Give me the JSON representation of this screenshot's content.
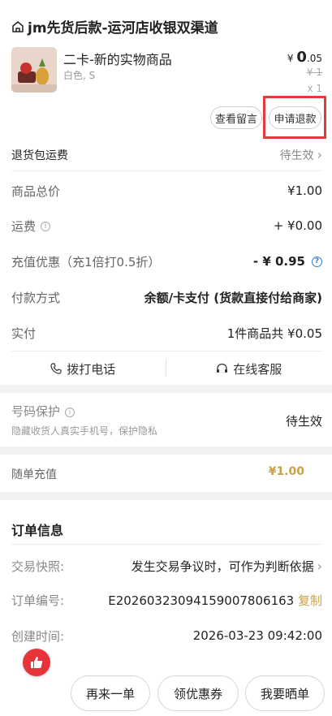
{
  "shop": {
    "name": "jm先货后款-运河店收银双渠道"
  },
  "product": {
    "title": "二卡-新的实物商品",
    "spec": "白色, S",
    "price_symbol": "¥",
    "price_int": "0",
    "price_dec": ".05",
    "orig_price": "¥ 1",
    "qty": "x 1"
  },
  "actions": {
    "msg_label": "查看留言",
    "refund_label": "申请退款"
  },
  "return_shipping": {
    "label": "退货包运费",
    "value": "待生效"
  },
  "summary": [
    {
      "label": "商品总价",
      "value": "¥1.00"
    },
    {
      "label": "运费",
      "value": "+ ¥0.00"
    },
    {
      "label": "充值优惠（充1倍打0.5折）",
      "value": "- ¥ 0.95"
    },
    {
      "label": "付款方式",
      "value": "余额/卡支付 (货款直接付给商家)"
    },
    {
      "label": "实付",
      "value": "1件商品共 ¥0.05"
    }
  ],
  "contact": {
    "call_label": "拨打电话",
    "service_label": "在线客服"
  },
  "protect": {
    "title": "号码保护",
    "desc": "隐藏收货人真实手机号，保护隐私",
    "value": "待生效"
  },
  "topup": {
    "label": "随单充值",
    "value": "¥1.00"
  },
  "order_info": {
    "title": "订单信息",
    "rows": [
      {
        "label": "交易快照:",
        "value": "发生交易争议时，可作为判断依据"
      },
      {
        "label": "订单编号:",
        "value": "E20260323094159007806163",
        "action": "复制"
      },
      {
        "label": "创建时间:",
        "value": "2026-03-23 09:42:00"
      }
    ]
  },
  "bottom": {
    "btn1": "再来一单",
    "btn2": "领优惠券",
    "btn3": "我要晒单"
  },
  "colors": {
    "accent_red": "#e23b3b",
    "gold": "#c9a24a",
    "blue": "#3a7bd5"
  }
}
